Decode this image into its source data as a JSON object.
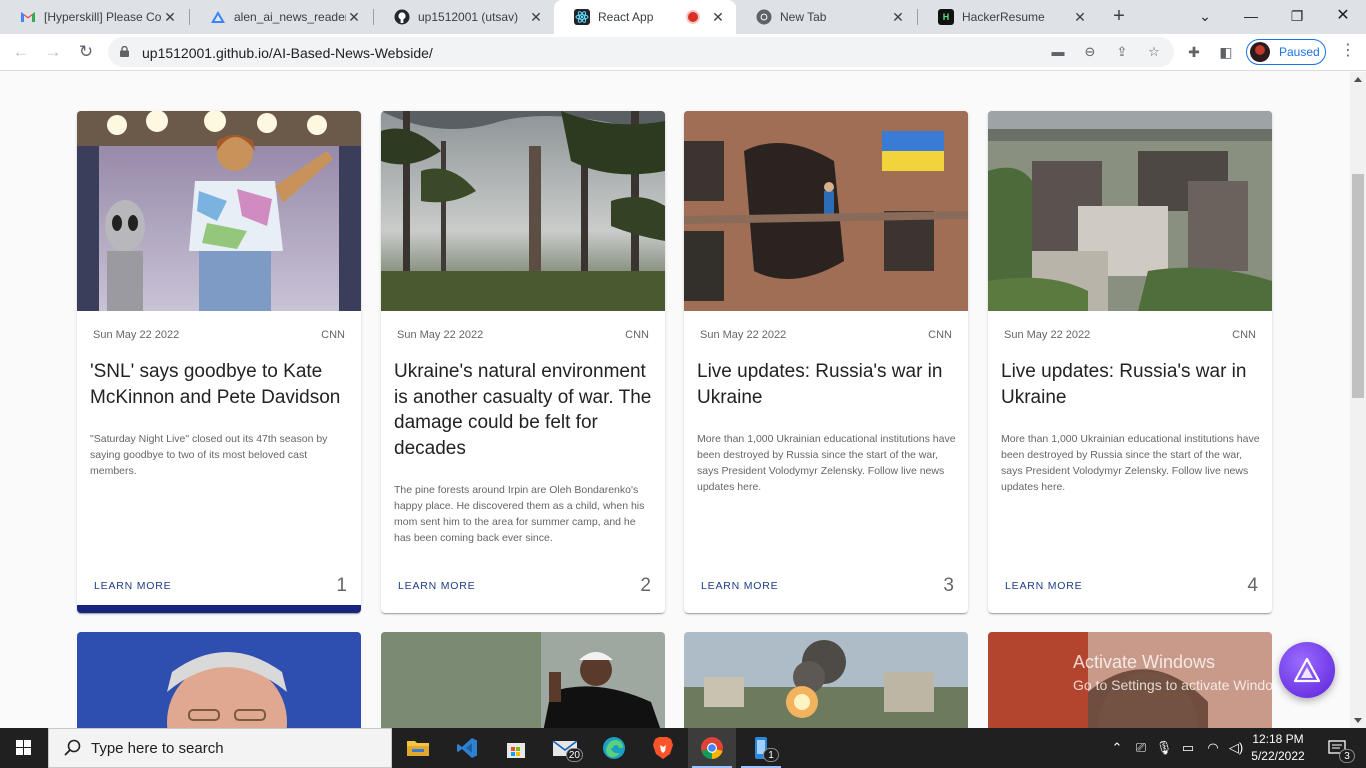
{
  "browser": {
    "tabs": [
      {
        "title": "[Hyperskill] Please Con",
        "icon": "gmail-icon"
      },
      {
        "title": "alen_ai_news_reader_a",
        "icon": "alan-icon"
      },
      {
        "title": "up1512001 (utsav)",
        "icon": "github-icon"
      },
      {
        "title": "React App",
        "icon": "react-icon",
        "active": true,
        "recording": true
      },
      {
        "title": "New Tab",
        "icon": "chrome-icon"
      },
      {
        "title": "HackerResume",
        "icon": "hackerresume-icon"
      }
    ],
    "url": "up1512001.github.io/AI-Based-News-Webside/",
    "profile_label": "Paused"
  },
  "articles": [
    {
      "date": "Sun May 22 2022",
      "source": "CNN",
      "title": "'SNL' says goodbye to Kate McKinnon and Pete Davidson",
      "description": "\"Saturday Night Live\" closed out its 47th season by saying goodbye to two of its most beloved cast members.",
      "action": "LEARN MORE",
      "number": "1",
      "highlighted": true
    },
    {
      "date": "Sun May 22 2022",
      "source": "CNN",
      "title": "Ukraine's natural environment is another casualty of war. The damage could be felt for decades",
      "description": "The pine forests around Irpin are Oleh Bondarenko's happy place. He discovered them as a child, when his mom sent him to the area for summer camp, and he has been coming back ever since.",
      "action": "LEARN MORE",
      "number": "2"
    },
    {
      "date": "Sun May 22 2022",
      "source": "CNN",
      "title": "Live updates: Russia's war in Ukraine",
      "description": "More than 1,000 Ukrainian educational institutions have been destroyed by Russia since the start of the war, says President Volodymyr Zelensky. Follow live news updates here.",
      "action": "LEARN MORE",
      "number": "3"
    },
    {
      "date": "Sun May 22 2022",
      "source": "CNN",
      "title": "Live updates: Russia's war in Ukraine",
      "description": "More than 1,000 Ukrainian educational institutions have been destroyed by Russia since the start of the war, says President Volodymyr Zelensky. Follow live news updates here.",
      "action": "LEARN MORE",
      "number": "4"
    }
  ],
  "overlay": {
    "activate_title": "Activate Windows",
    "activate_sub": "Go to Settings to activate Windows."
  },
  "taskbar": {
    "search_placeholder": "Type here to search",
    "mail_badge": "20",
    "phone_badge": "1",
    "time": "12:18 PM",
    "date": "5/22/2022",
    "notification_count": "3"
  },
  "colors": {
    "accent_bar": "#1a237e",
    "learn_more": "#1e3a8a",
    "alan_button": "#6c2bd9"
  }
}
